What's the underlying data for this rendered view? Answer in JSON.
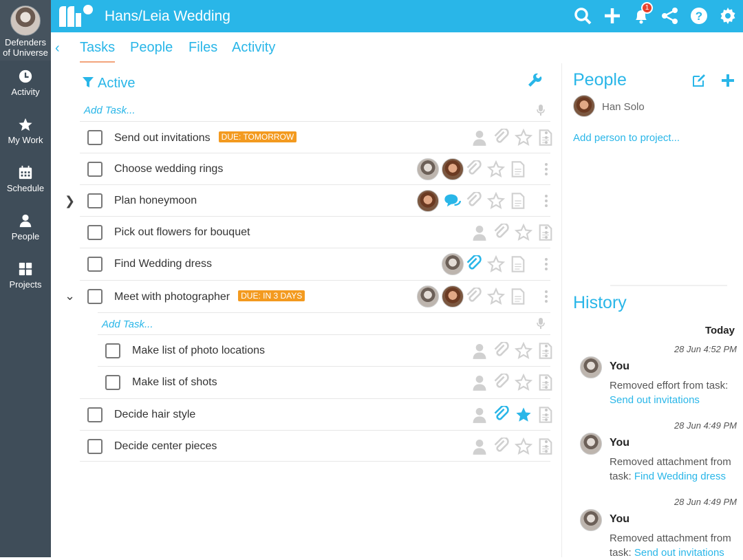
{
  "rail": {
    "team_name": "Defenders of Universe",
    "items": [
      {
        "label": "Activity",
        "icon": "clock-icon"
      },
      {
        "label": "My Work",
        "icon": "star-icon"
      },
      {
        "label": "Schedule",
        "icon": "calendar-icon"
      },
      {
        "label": "People",
        "icon": "person-icon"
      },
      {
        "label": "Projects",
        "icon": "grid-icon"
      }
    ]
  },
  "topbar": {
    "title": "Hans/Leia Wedding",
    "notification_count": "1",
    "colors": {
      "bar": "#29b6e8",
      "badge": "#e8412c"
    }
  },
  "tabs": [
    "Tasks",
    "People",
    "Files",
    "Activity"
  ],
  "filter": {
    "label": "Active"
  },
  "add_task_label": "Add Task...",
  "tasks": [
    {
      "name": "Send out invitations",
      "due": "DUE: TOMORROW"
    },
    {
      "name": "Choose wedding rings",
      "due": ""
    },
    {
      "name": "Plan honeymoon",
      "due": ""
    },
    {
      "name": "Pick out flowers for bouquet",
      "due": ""
    },
    {
      "name": "Find Wedding dress",
      "due": ""
    },
    {
      "name": "Meet with photographer",
      "due": "DUE: IN 3 DAYS"
    },
    {
      "name": "Make list of photo locations",
      "due": ""
    },
    {
      "name": "Make list of shots",
      "due": ""
    },
    {
      "name": "Decide hair style",
      "due": ""
    },
    {
      "name": "Decide center pieces",
      "due": ""
    }
  ],
  "right": {
    "people_title": "People",
    "person": "Han Solo",
    "add_person": "Add person to project...",
    "history_title": "History",
    "today": "Today",
    "history": [
      {
        "time": "28 Jun 4:52 PM",
        "who": "You",
        "text": "Removed effort from task:",
        "link": "Send out invitations"
      },
      {
        "time": "28 Jun 4:49 PM",
        "who": "You",
        "text": "Removed attachment from task:",
        "link": "Find Wedding dress"
      },
      {
        "time": "28 Jun 4:49 PM",
        "who": "You",
        "text": "Removed attachment from task:",
        "link": "Send out invitations"
      }
    ]
  }
}
